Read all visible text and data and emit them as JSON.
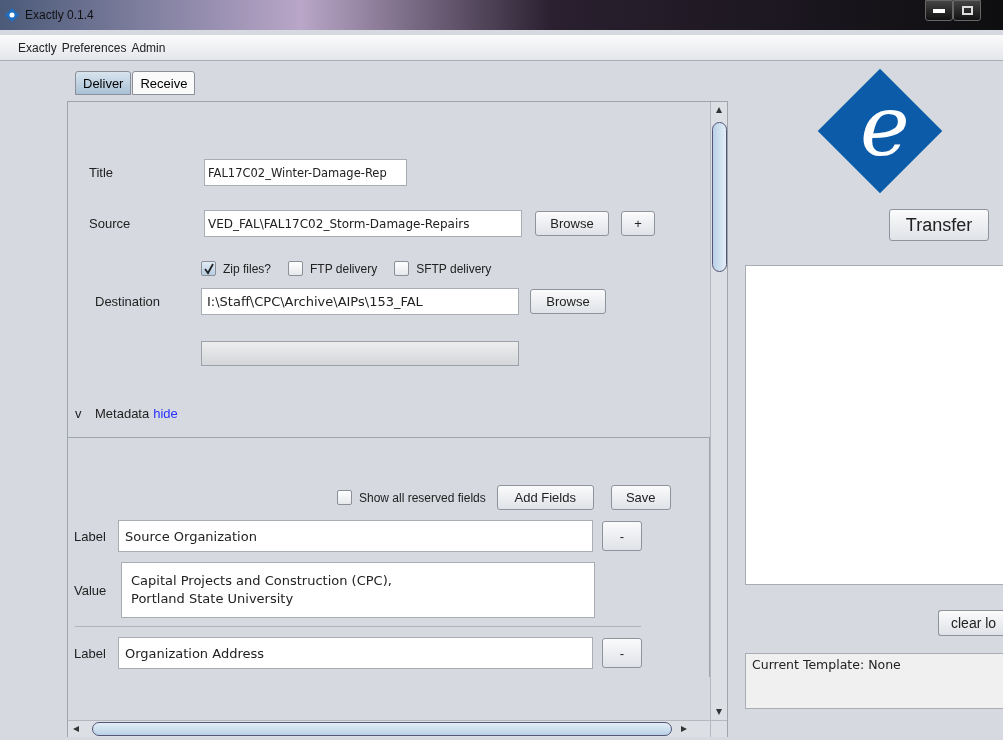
{
  "window": {
    "title": "Exactly 0.1.4"
  },
  "menu": [
    "Exactly",
    "Preferences",
    "Admin"
  ],
  "tabs": [
    {
      "label": "Deliver",
      "selected": true
    },
    {
      "label": "Receive",
      "selected": false
    }
  ],
  "deliver": {
    "title_label": "Title",
    "title_value": "FAL17C02_Winter-Damage-Rep",
    "source_label": "Source",
    "source_value": "VED_FAL\\FAL17C02_Storm-Damage-Repairs",
    "browse_source": "Browse",
    "add_source": "+",
    "options": [
      {
        "label": "Zip files?",
        "checked": true
      },
      {
        "label": "FTP delivery",
        "checked": false
      },
      {
        "label": "SFTP delivery",
        "checked": false
      }
    ],
    "destination_label": "Destination",
    "destination_value": "I:\\Staff\\CPC\\Archive\\AIPs\\153_FAL",
    "browse_destination": "Browse",
    "progress": {
      "level": 0
    },
    "metadata": {
      "toggle": "v",
      "label": "Metadata",
      "link": "hide"
    },
    "fields_panel": {
      "show_reserved": {
        "label": "Show all reserved fields",
        "checked": false
      },
      "add_fields": "Add Fields",
      "save": "Save",
      "entries": [
        {
          "label_caption": "Label",
          "label_value": "Source Organization",
          "remove": "-",
          "value_caption": "Value",
          "value": "Capital Projects and Construction (CPC),\nPortland State University"
        },
        {
          "label_caption": "Label",
          "label_value": "Organization Address",
          "remove": "-"
        }
      ]
    }
  },
  "right": {
    "logo_letter": "e",
    "transfer": "Transfer",
    "clear_log": "clear lo",
    "template_status": "Current Template: None"
  }
}
